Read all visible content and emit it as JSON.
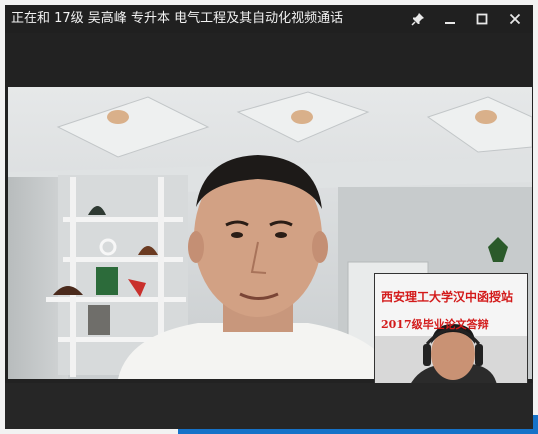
{
  "window": {
    "title": "正在和 17级 吴高峰  专升本 电气工程及其自动化视频通话"
  },
  "controls": {
    "pin_icon": "pin-icon",
    "minimize_icon": "minimize-icon",
    "maximize_icon": "maximize-icon",
    "close_icon": "close-icon"
  },
  "pip": {
    "banner_line1": "西安理工大学汉中函授站",
    "banner_line2": "2017级毕业论文答辩"
  },
  "colors": {
    "titlebar": "#202020",
    "banner_text": "#d31a1a",
    "taskbar_edge": "#1672c8"
  }
}
